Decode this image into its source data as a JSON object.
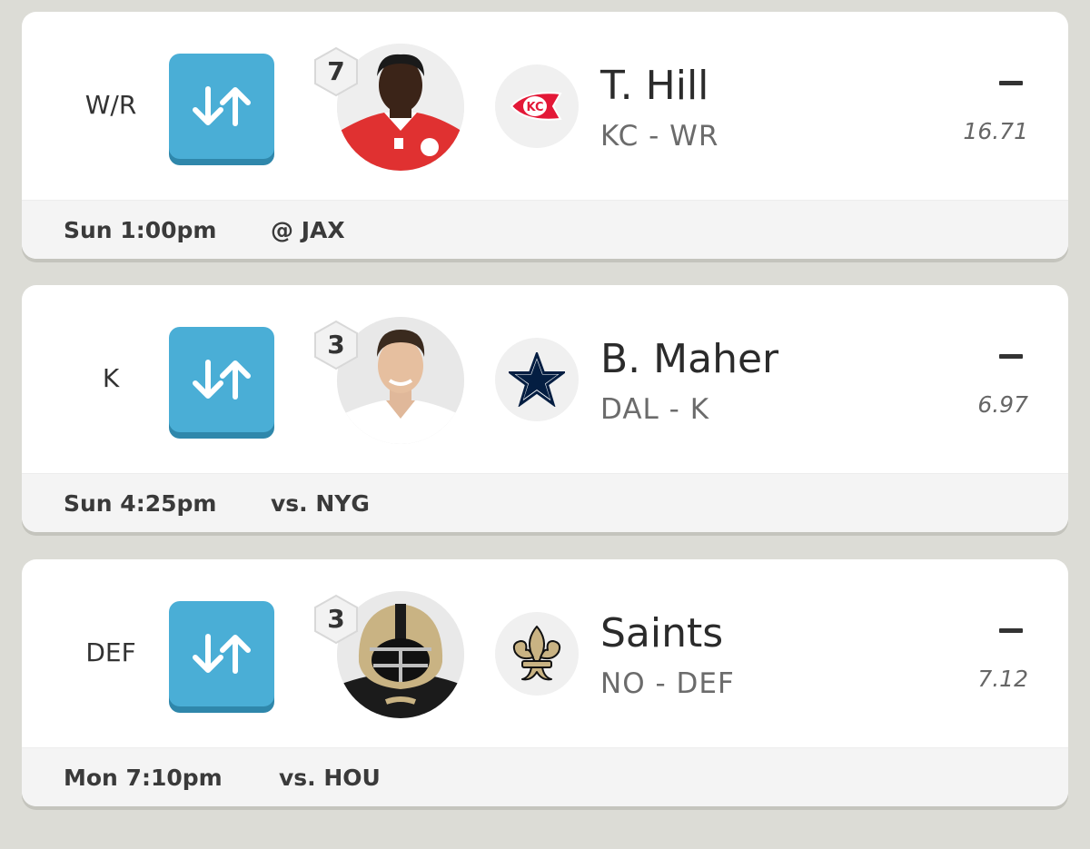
{
  "roster": [
    {
      "slot": "W/R",
      "rank": "7",
      "name": "T. Hill",
      "team_position": "KC - WR",
      "score": "–",
      "projection": "16.71",
      "game_time": "Sun 1:00pm",
      "opponent": "@ JAX",
      "team_logo": "chiefs-logo-icon",
      "photo": "player-photo-hill",
      "accent": "#e31837"
    },
    {
      "slot": "K",
      "rank": "3",
      "name": "B. Maher",
      "team_position": "DAL - K",
      "score": "–",
      "projection": "6.97",
      "game_time": "Sun 4:25pm",
      "opponent": "vs. NYG",
      "team_logo": "cowboys-star-icon",
      "photo": "player-photo-maher",
      "accent": "#041e42"
    },
    {
      "slot": "DEF",
      "rank": "3",
      "name": "Saints",
      "team_position": "NO - DEF",
      "score": "–",
      "projection": "7.12",
      "game_time": "Mon 7:10pm",
      "opponent": "vs. HOU",
      "team_logo": "fleur-de-lis-icon",
      "photo": "defense-helmet-photo",
      "accent": "#d3bc8d"
    }
  ],
  "colors": {
    "swap_button": "#4aaed6",
    "swap_button_shadow": "#2f87ab",
    "background": "#dcdcd6"
  }
}
